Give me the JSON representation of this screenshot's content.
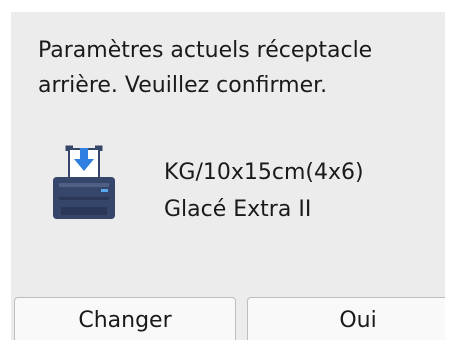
{
  "dialog": {
    "message_line1": "Paramètres actuels réceptacle",
    "message_line2": "arrière. Veuillez confirmer.",
    "icon": "printer-rear-tray-icon",
    "paper_size": "KG/10x15cm(4x6)",
    "paper_type": "Glacé Extra II"
  },
  "buttons": {
    "change_label": "Changer",
    "ok_label": "Oui"
  },
  "colors": {
    "screen_background": "#ececec",
    "printer_body": "#36466a",
    "arrow_accent": "#2f7fe0"
  }
}
